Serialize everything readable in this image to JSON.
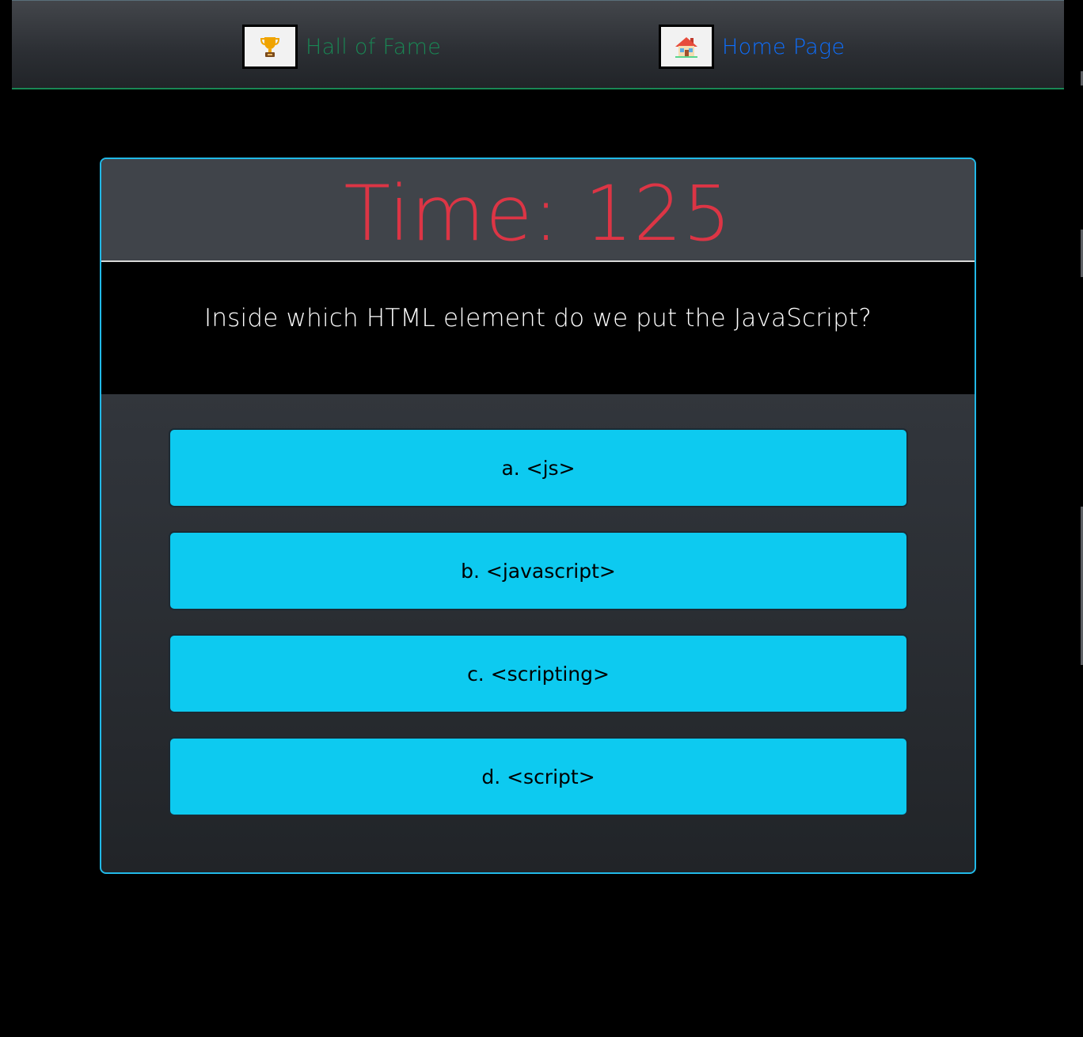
{
  "nav": {
    "hall_of_fame_label": "Hall of Fame",
    "home_page_label": "Home Page",
    "hall_of_fame_icon": "trophy-icon",
    "home_page_icon": "house-icon",
    "hall_of_fame_color": "#198754",
    "home_page_color": "#0d6efd"
  },
  "quiz": {
    "timer_text": "Time: 125",
    "question": "Inside which HTML element do we put the JavaScript?",
    "answers": [
      {
        "label": "a. <js>"
      },
      {
        "label": "b. <javascript>"
      },
      {
        "label": "c. <scripting>"
      },
      {
        "label": "d. <script>"
      }
    ],
    "timer_color": "#dc3545",
    "answer_color": "#0dcaf0",
    "card_border_color": "#21b9e8"
  }
}
